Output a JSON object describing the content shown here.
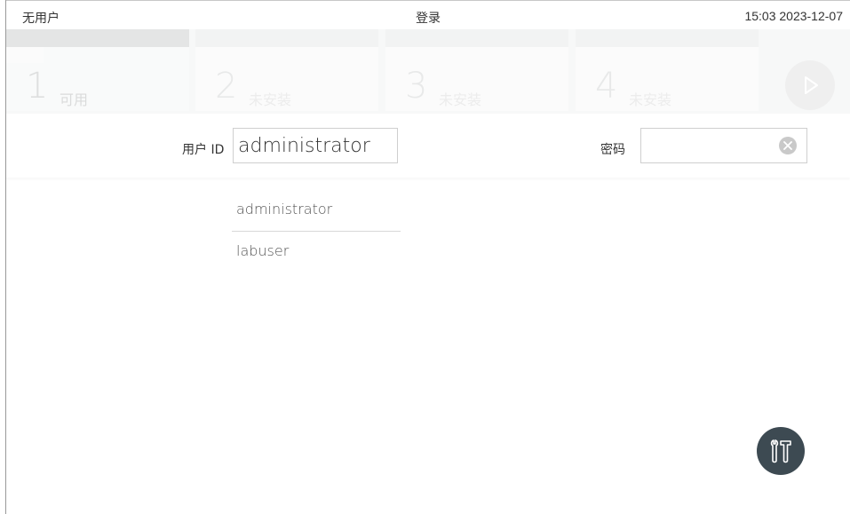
{
  "statusbar": {
    "user": "无用户",
    "title": "登录",
    "time": "15:03 2023-12-07"
  },
  "modules": [
    {
      "number": "1",
      "state": "可用"
    },
    {
      "number": "2",
      "state": "未安装"
    },
    {
      "number": "3",
      "state": "未安装"
    },
    {
      "number": "4",
      "state": "未安装"
    }
  ],
  "login": {
    "user_label": "用户 ID",
    "user_value": "administrator",
    "password_label": "密码",
    "password_value": ""
  },
  "user_list": [
    "administrator",
    "labuser"
  ],
  "icons": {
    "run": "play-icon",
    "clear": "clear-icon",
    "tools": "tools-icon"
  },
  "colors": {
    "tools_button": "#3d4a52"
  }
}
